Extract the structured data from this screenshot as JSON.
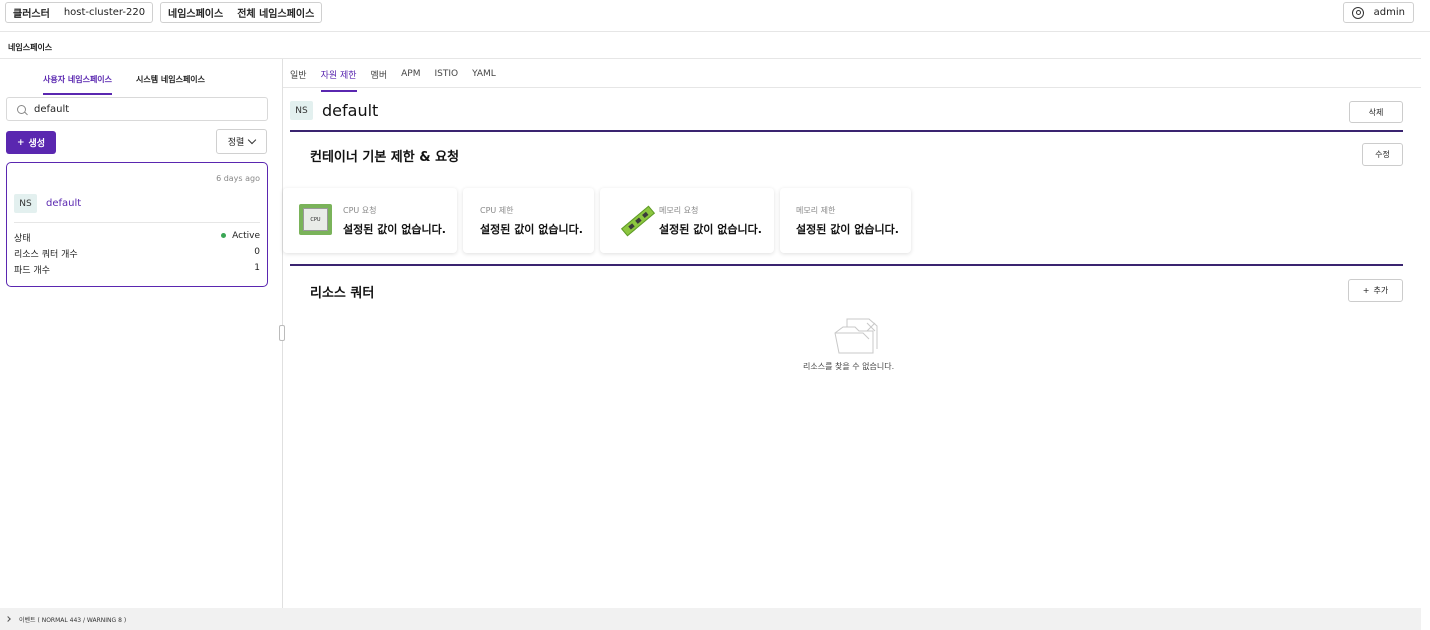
{
  "topbar": {
    "cluster_label": "클러스터",
    "cluster_value": "host-cluster-220",
    "namespace_label": "네임스페이스",
    "namespace_value": "전체 네임스페이스",
    "user_icon": "user-circle-icon",
    "user_name": "admin"
  },
  "page": {
    "heading": "네임스페이스"
  },
  "sidebar": {
    "tabs": [
      {
        "label": "사용자 네임스페이스",
        "active": true
      },
      {
        "label": "시스템 네임스페이스",
        "active": false
      }
    ],
    "search": {
      "value": "default",
      "icon": "search-icon"
    },
    "create_label": "생성",
    "sort_label": "정렬",
    "card": {
      "age": "6 days ago",
      "badge": "NS",
      "name": "default",
      "rows": [
        {
          "key": "상태",
          "value": "Active"
        },
        {
          "key": "리소스 쿼터 개수",
          "value": "0"
        },
        {
          "key": "파드 개수",
          "value": "1"
        }
      ],
      "status_color": "#3aa655"
    }
  },
  "main": {
    "tabs": [
      {
        "label": "일반",
        "active": false
      },
      {
        "label": "자원 제한",
        "active": true
      },
      {
        "label": "멤버",
        "active": false
      },
      {
        "label": "APM",
        "active": false
      },
      {
        "label": "ISTIO",
        "active": false
      },
      {
        "label": "YAML",
        "active": false
      }
    ],
    "badge": "NS",
    "title": "default",
    "delete_label": "삭제",
    "limits_section": {
      "title": "컨테이너 기본 제한 & 요청",
      "edit_label": "수정",
      "cards": [
        {
          "label": "CPU 요청",
          "value": "설정된 값이 없습니다.",
          "icon": "cpu-chip-icon",
          "icon_text": "CPU"
        },
        {
          "label": "CPU 제한",
          "value": "설정된 값이 없습니다."
        },
        {
          "label": "메모리 요청",
          "value": "설정된 값이 없습니다.",
          "icon": "memory-module-icon"
        },
        {
          "label": "메모리 제한",
          "value": "설정된 값이 없습니다."
        }
      ]
    },
    "quota_section": {
      "title": "리소스 쿼터",
      "add_label": "추가",
      "empty_icon": "empty-folder-icon",
      "empty_text": "리소스를 찾을 수 없습니다."
    }
  },
  "bottombar": {
    "text": "이벤트 ( NORMAL 443 / WARNING 8 )"
  },
  "colors": {
    "accent": "#5a27b0",
    "divider": "#3a2470",
    "badge_bg": "#e3f0ef"
  }
}
